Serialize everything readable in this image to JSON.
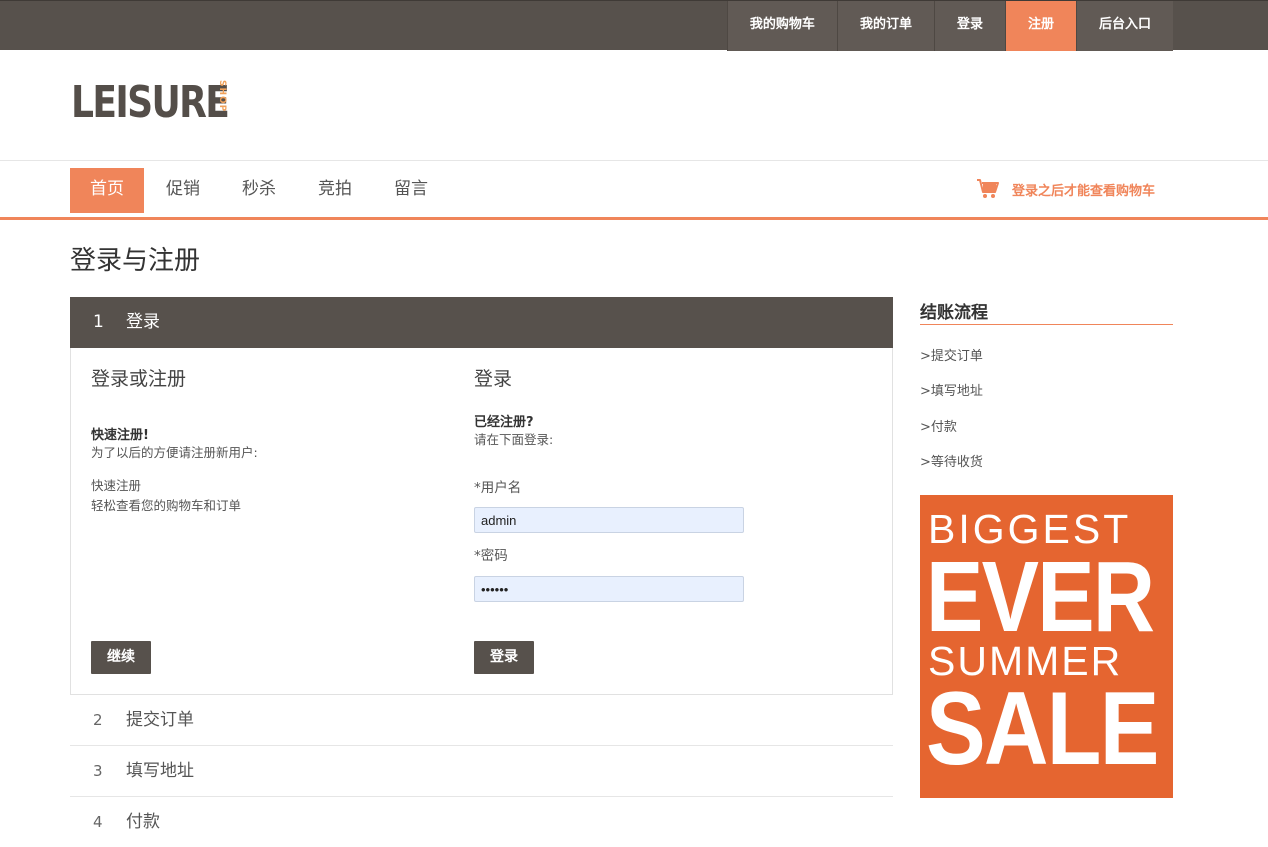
{
  "topnav": {
    "items": [
      {
        "label": "我的购物车"
      },
      {
        "label": "我的订单"
      },
      {
        "label": "登录"
      },
      {
        "label": "注册",
        "active": true
      },
      {
        "label": "后台入口"
      }
    ]
  },
  "logo": {
    "main": "LEISURE",
    "sub": "SHOP"
  },
  "mainnav": {
    "items": [
      {
        "label": "首页",
        "active": true
      },
      {
        "label": "促销"
      },
      {
        "label": "秒杀"
      },
      {
        "label": "竞拍"
      },
      {
        "label": "留言"
      }
    ],
    "cart_note": "登录之后才能查看购物车",
    "cart_icon": "shopping-cart-icon"
  },
  "page_title": "登录与注册",
  "steps": [
    {
      "num": "1",
      "label": "登录"
    },
    {
      "num": "2",
      "label": "提交订单"
    },
    {
      "num": "3",
      "label": "填写地址"
    },
    {
      "num": "4",
      "label": "付款"
    }
  ],
  "register": {
    "title": "登录或注册",
    "bold": "快速注册!",
    "desc": "为了以后的方便请注册新用户:",
    "line1": "快速注册",
    "line2": "轻松查看您的购物车和订单",
    "button": "继续"
  },
  "login": {
    "title": "登录",
    "bold": "已经注册?",
    "desc": "请在下面登录:",
    "username_label": "*用户名",
    "username_value": "admin",
    "password_label": "*密码",
    "password_value": "••••••",
    "button": "登录"
  },
  "sidebar": {
    "title": "结账流程",
    "links": [
      ">提交订单",
      ">填写地址",
      ">付款",
      ">等待收货"
    ]
  },
  "promo": {
    "line1": "BIGGEST",
    "line2": "EVER",
    "line3": "SUMMER",
    "line4": "SALE"
  },
  "colors": {
    "accent": "#f0855a",
    "dark": "#57514c",
    "promo_bg": "#e56530"
  }
}
